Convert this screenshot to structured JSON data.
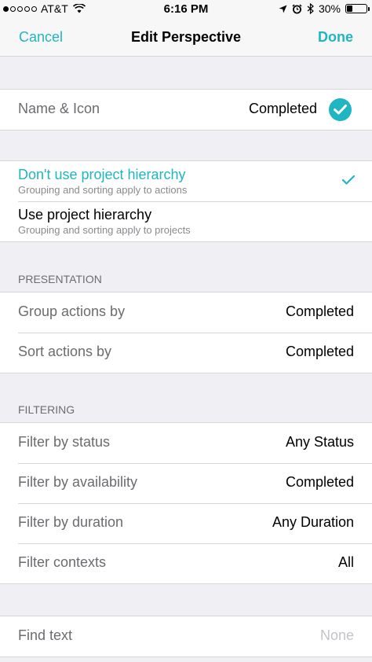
{
  "status_bar": {
    "carrier": "AT&T",
    "time": "6:16 PM",
    "battery": "30%",
    "battery_level": 0.3
  },
  "nav": {
    "cancel": "Cancel",
    "title": "Edit Perspective",
    "done": "Done"
  },
  "name_icon": {
    "label": "Name & Icon",
    "value": "Completed"
  },
  "hierarchy": [
    {
      "title": "Don't use project hierarchy",
      "subtitle": "Grouping and sorting apply to actions",
      "selected": true
    },
    {
      "title": "Use project hierarchy",
      "subtitle": "Grouping and sorting apply to projects",
      "selected": false
    }
  ],
  "presentation": {
    "header": "PRESENTATION",
    "rows": [
      {
        "label": "Group actions by",
        "value": "Completed"
      },
      {
        "label": "Sort actions by",
        "value": "Completed"
      }
    ]
  },
  "filtering": {
    "header": "FILTERING",
    "rows": [
      {
        "label": "Filter by status",
        "value": "Any Status"
      },
      {
        "label": "Filter by availability",
        "value": "Completed"
      },
      {
        "label": "Filter by duration",
        "value": "Any Duration"
      },
      {
        "label": "Filter contexts",
        "value": "All"
      }
    ]
  },
  "find_text": {
    "label": "Find text",
    "value": "None"
  },
  "colors": {
    "accent": "#1fb5c3",
    "background": "#efeff4",
    "separator": "#d6d6da"
  }
}
